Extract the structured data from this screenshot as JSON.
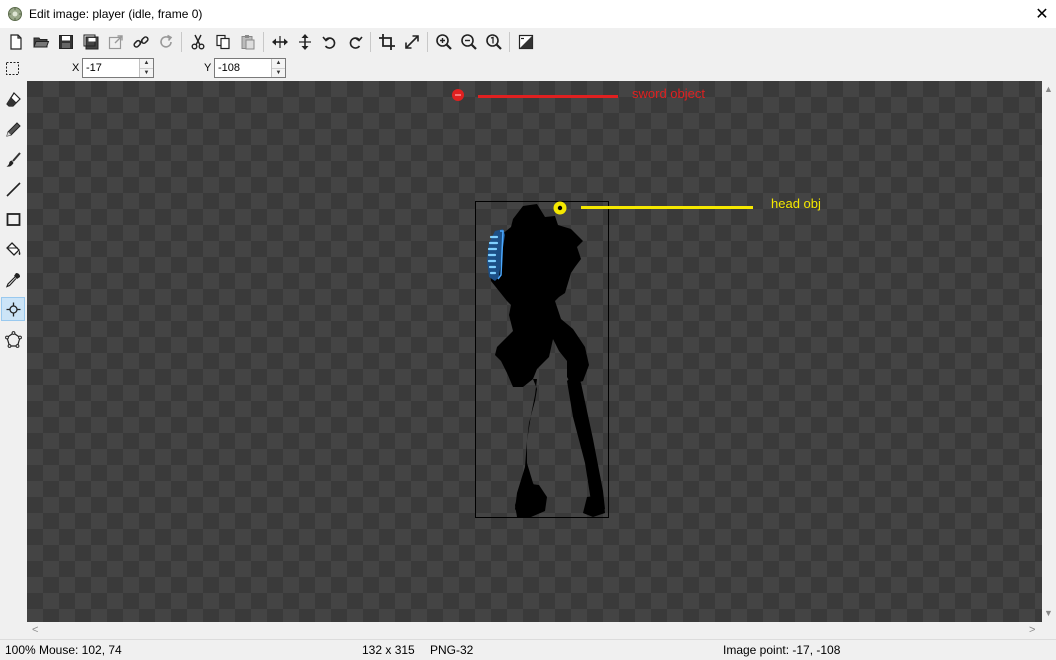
{
  "window": {
    "title": "Edit image: player (idle, frame 0)",
    "close_glyph": "✕"
  },
  "toolbar": {
    "icons": [
      "new-file-icon",
      "open-folder-icon",
      "save-icon",
      "save-as-icon",
      "export-icon",
      "link-icon",
      "refresh-icon",
      "cut-icon",
      "copy-icon",
      "paste-icon",
      "flip-horizontal-icon",
      "flip-vertical-icon",
      "undo-icon",
      "redo-icon",
      "crop-icon",
      "resize-icon",
      "zoom-in-icon",
      "zoom-out-icon",
      "zoom-reset-icon",
      "image-adjust-icon"
    ]
  },
  "coords": {
    "x_label": "X",
    "x_value": "-17",
    "y_label": "Y",
    "y_value": "-108"
  },
  "tools": [
    "eraser-icon",
    "pencil-icon",
    "brush-icon",
    "line-icon",
    "rectangle-icon",
    "fill-icon",
    "eyedropper-icon",
    "origin-point-icon",
    "polygon-icon"
  ],
  "active_tool": "origin-point-icon",
  "canvas": {
    "annotations": {
      "sword_label": "sword object",
      "sword_color": "#e02020",
      "head_label": "head obj",
      "head_color": "#f5e800"
    },
    "scroll_up": "▲",
    "scroll_down": "▼",
    "scroll_left": "<",
    "scroll_right": ">"
  },
  "status": {
    "zoom": "100%",
    "mouse": "Mouse: 102, 74",
    "dimensions": "132 x 315",
    "format": "PNG-32",
    "image_point": "Image point: -17, -108"
  }
}
